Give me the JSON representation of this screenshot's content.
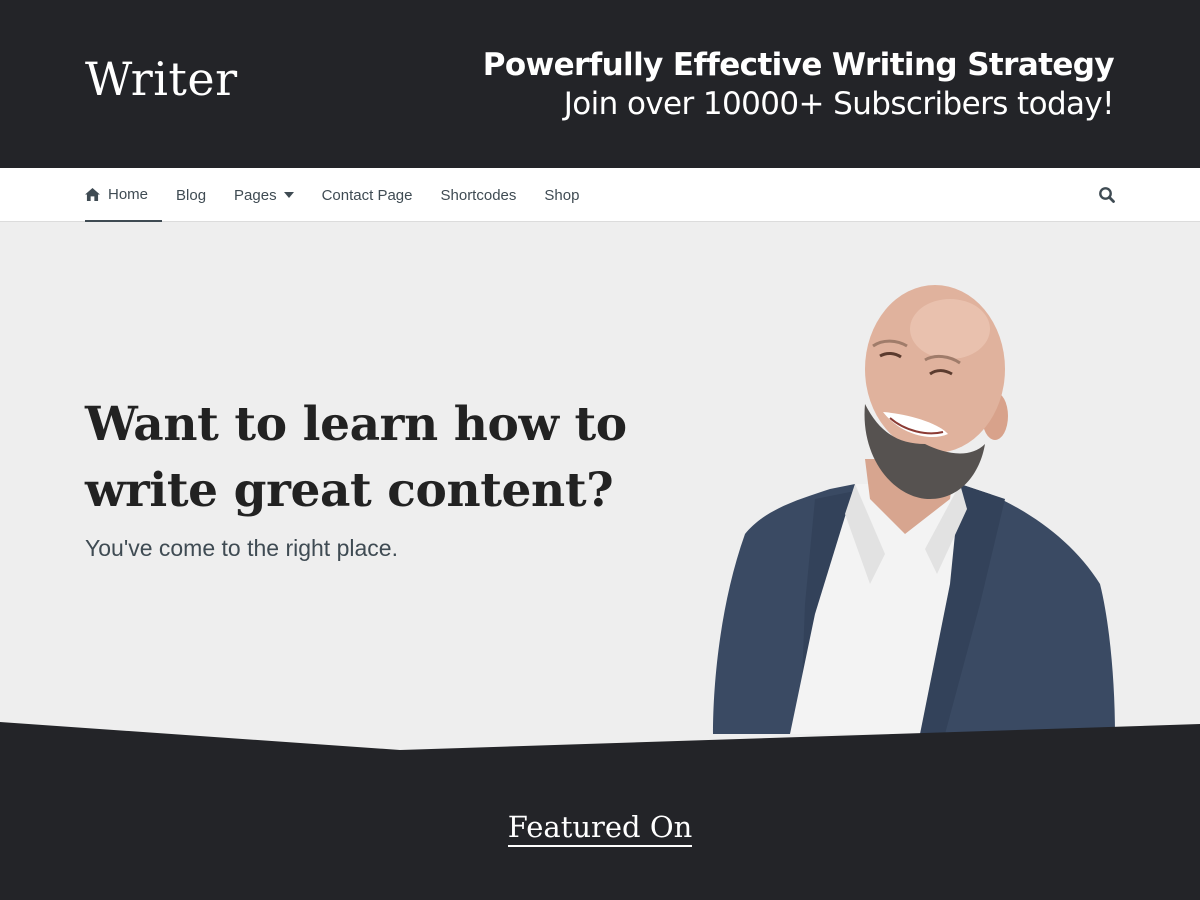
{
  "header": {
    "logo": "Writer",
    "tagline_bold": "Powerfully Effective Writing Strategy",
    "tagline_rest": " Join over 10000+ Subscribers today!"
  },
  "nav": {
    "items": [
      {
        "label": "Home",
        "icon": "home-icon"
      },
      {
        "label": "Blog"
      },
      {
        "label": "Pages",
        "icon": "caret-down-icon"
      },
      {
        "label": "Contact Page"
      },
      {
        "label": "Shortcodes"
      },
      {
        "label": "Shop"
      }
    ],
    "active": "Home",
    "search_icon": "search-icon"
  },
  "hero": {
    "title": "Want to learn how to write great content?",
    "subtitle": "You've come to the right place."
  },
  "featured": {
    "title": "Featured On"
  },
  "colors": {
    "dark": "#232428",
    "hero_bg": "#eeeeee",
    "nav_text": "#3f4b53",
    "white": "#ffffff"
  }
}
